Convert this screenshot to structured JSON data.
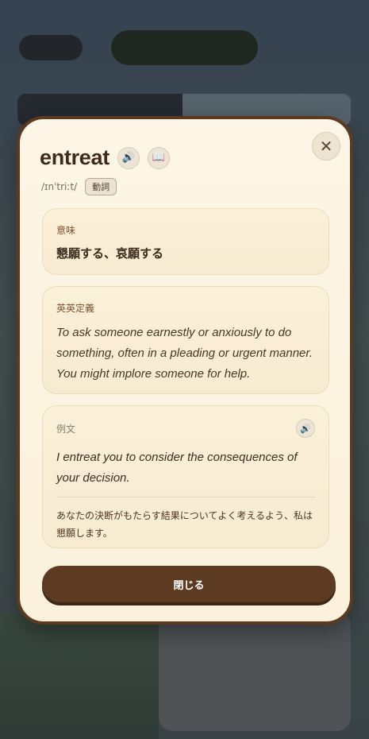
{
  "modal": {
    "close_icon": "close-icon",
    "word": "entreat",
    "phonetic": "/ɪnˈtriːt/",
    "part_of_speech": "動詞",
    "icons": {
      "sound": "speaker-icon",
      "dictionary": "book-icon"
    },
    "meaning": {
      "label": "意味",
      "text": "懇願する、哀願する"
    },
    "definition": {
      "label": "英英定義",
      "text": "To ask someone earnestly or anxiously to do something, often in a pleading or urgent manner. You might implore someone for help."
    },
    "example": {
      "label": "例文",
      "english": "I entreat you to consider the consequences of your decision.",
      "japanese": "あなたの決断がもたらす結果についてよく考えるよう、私は懇願します。"
    },
    "close_button_label": "閉じる"
  },
  "colors": {
    "modal_bg": "#fbf1dc",
    "modal_border": "#5c3a20",
    "accent_button": "#5d3b22",
    "label_brown": "#7d5232"
  }
}
